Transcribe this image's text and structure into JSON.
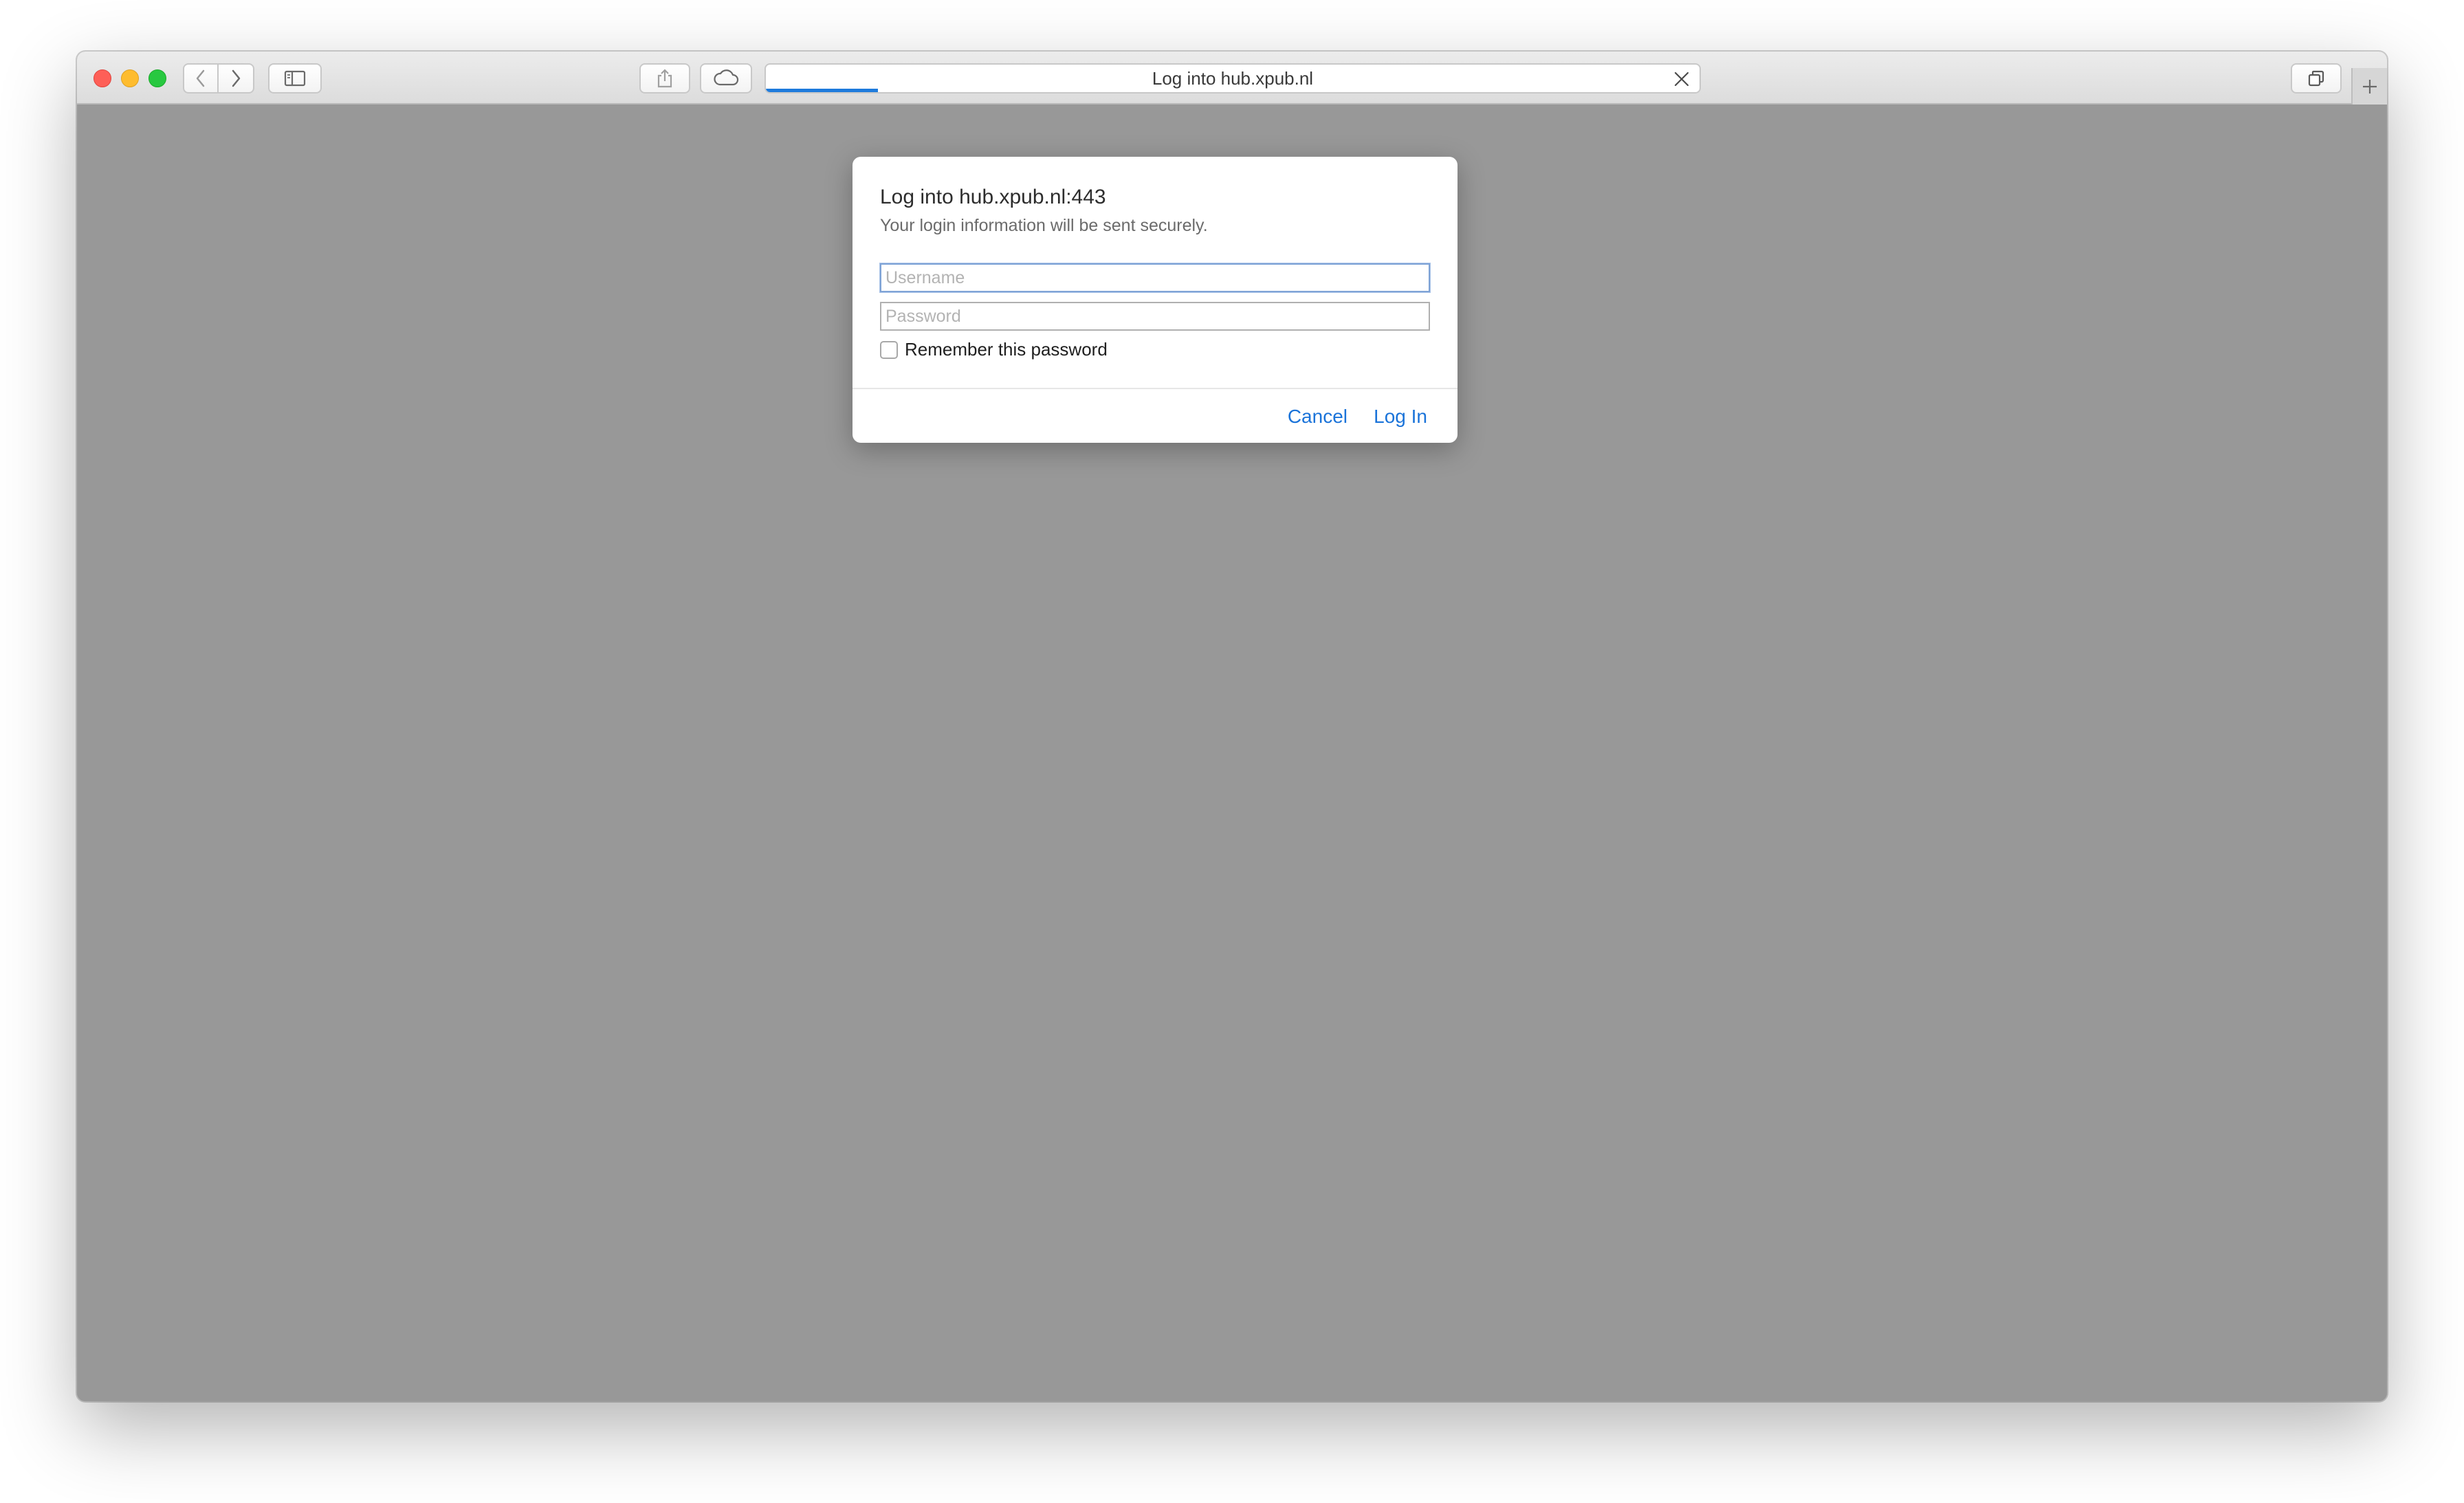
{
  "browser": {
    "address_bar": {
      "text": "Log into hub.xpub.nl",
      "load_progress": 0.12
    },
    "icons": {
      "back": "chevron-left-icon",
      "forward": "chevron-right-icon",
      "sidebar": "sidebar-icon",
      "share": "share-icon",
      "icloud": "cloud-icon",
      "stop": "close-icon",
      "tabs": "tab-overview-icon",
      "new_tab": "plus-icon"
    },
    "colors": {
      "accent": "#1e7bdc",
      "content_background": "#989898"
    }
  },
  "dialog": {
    "title": "Log into hub.xpub.nl:443",
    "subtitle": "Your login information will be sent securely.",
    "username_placeholder": "Username",
    "password_placeholder": "Password",
    "username_value": "",
    "password_value": "",
    "remember_label": "Remember this password",
    "remember_checked": false,
    "cancel_label": "Cancel",
    "login_label": "Log In",
    "button_color": "#1a73d9"
  }
}
